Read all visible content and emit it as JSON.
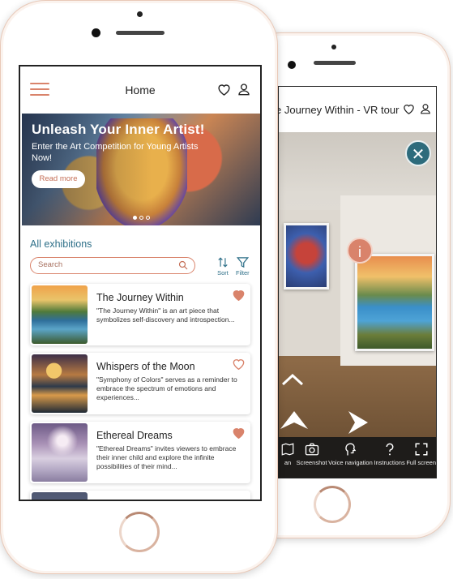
{
  "front": {
    "header": {
      "title": "Home",
      "menu_icon": "hamburger-icon",
      "fav_icon": "heart-icon",
      "profile_icon": "user-icon"
    },
    "hero": {
      "title": "Unleash Your Inner Artist!",
      "subtitle": "Enter the Art Competition for Young Artists Now!",
      "button_label": "Read more",
      "slides_total": 3,
      "slide_active": 1
    },
    "section_title": "All exhibitions",
    "search": {
      "placeholder": "Search",
      "icon": "search-icon"
    },
    "sort_label": "Sort",
    "filter_label": "Filter",
    "exhibitions": [
      {
        "title": "The Journey Within",
        "description": "\"The Journey Within\" is an art piece that symbolizes self-discovery and introspection...",
        "favorited": true
      },
      {
        "title": "Whispers of the Moon",
        "description": "\"Symphony of Colors\" serves as a reminder to embrace the spectrum of emotions and experiences...",
        "favorited": false
      },
      {
        "title": "Ethereal Dreams",
        "description": "\"Ethereal Dreams\" invites viewers to embrace their inner child and explore the infinite possibilities of their mind...",
        "favorited": true
      }
    ]
  },
  "back": {
    "header_title": "e Journey Within - VR tour",
    "toolbar": [
      {
        "label": "an",
        "icon": "map-icon"
      },
      {
        "label": "Screenshot",
        "icon": "camera-icon"
      },
      {
        "label": "Voice navigation",
        "icon": "voice-icon"
      },
      {
        "label": "Instructions",
        "icon": "question-icon"
      },
      {
        "label": "Full screen",
        "icon": "fullscreen-icon"
      }
    ],
    "info_label": "i",
    "close_label": "✕"
  },
  "colors": {
    "accent": "#d9836b",
    "teal": "#2f7089",
    "dark_teal": "#2d6b7c"
  }
}
